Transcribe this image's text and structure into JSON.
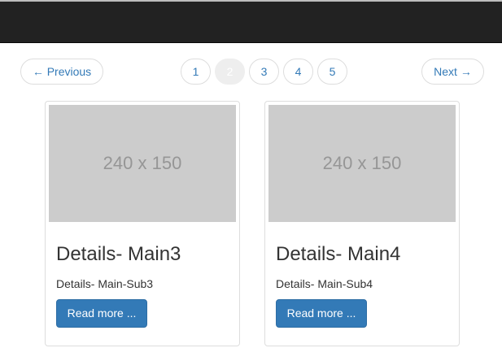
{
  "pager": {
    "previous_label": "← Previous",
    "next_label": "Next →",
    "pages": [
      "1",
      "2",
      "3",
      "4",
      "5"
    ],
    "active_page": "2"
  },
  "cards": [
    {
      "image_placeholder": "240 x 150",
      "title": "Details- Main3",
      "text": "Details- Main-Sub3",
      "button_label": "Read more ..."
    },
    {
      "image_placeholder": "240 x 150",
      "title": "Details- Main4",
      "text": "Details- Main-Sub4",
      "button_label": "Read more ..."
    }
  ],
  "colors": {
    "navbar": "#222222",
    "link": "#337ab7",
    "primary_button": "#337ab7",
    "placeholder_bg": "#cccccc",
    "active_page_bg": "#eeeeee"
  }
}
